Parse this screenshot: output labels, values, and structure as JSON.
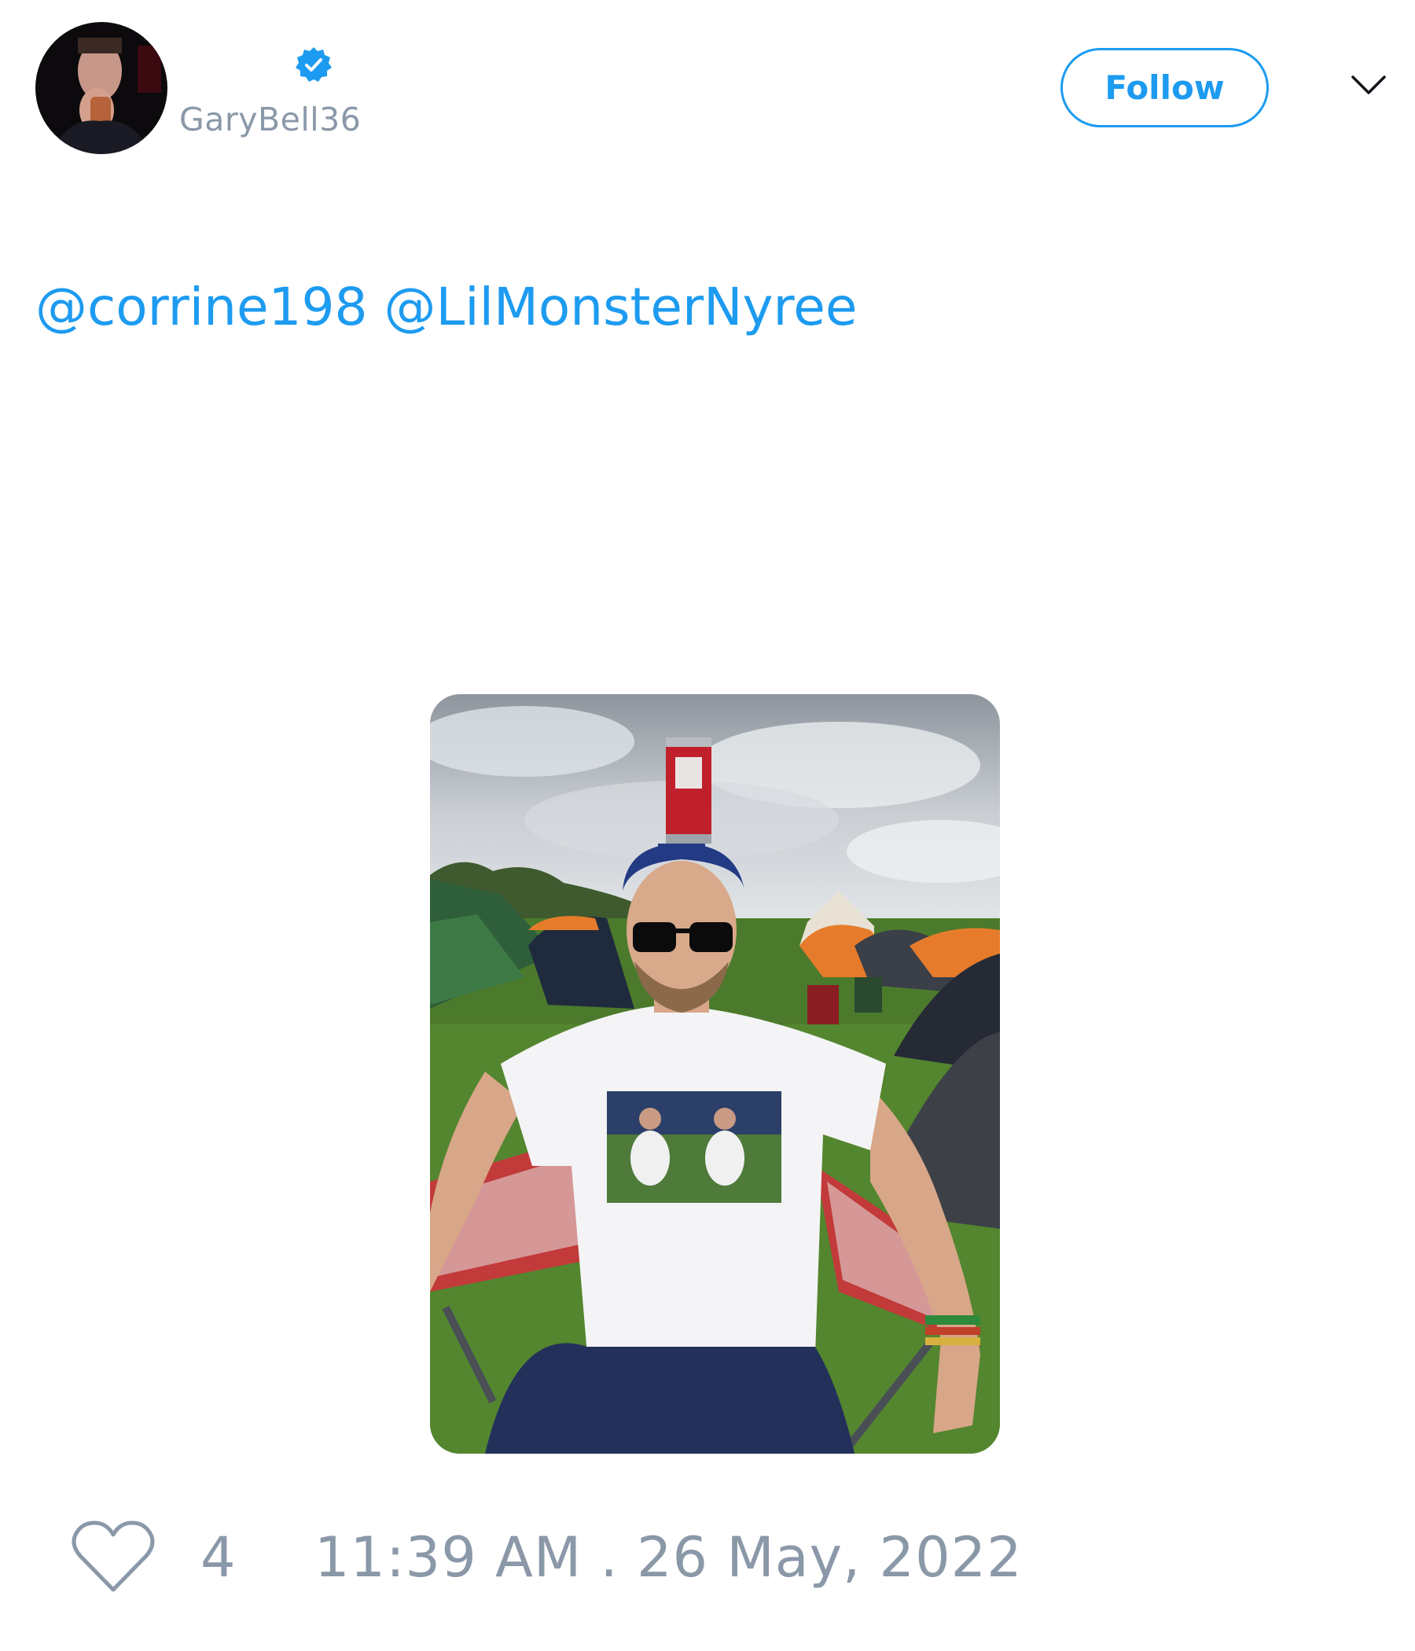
{
  "author": {
    "display_name": "",
    "handle": "GaryBell36",
    "verified": true,
    "avatar_icon": "profile-photo"
  },
  "header": {
    "follow_label": "Follow",
    "menu_icon": "chevron-down-icon"
  },
  "tweet": {
    "mentions": [
      "@corrine198",
      "@LilMonsterNyree"
    ],
    "media_description_icon": "attached-photo"
  },
  "footer": {
    "like_icon": "heart-icon",
    "like_count": "4",
    "timestamp": "11:39 AM . 26 May, 2022"
  },
  "colors": {
    "accent": "#1d9bf0",
    "muted": "#8a98a8",
    "background": "#ffffff"
  }
}
